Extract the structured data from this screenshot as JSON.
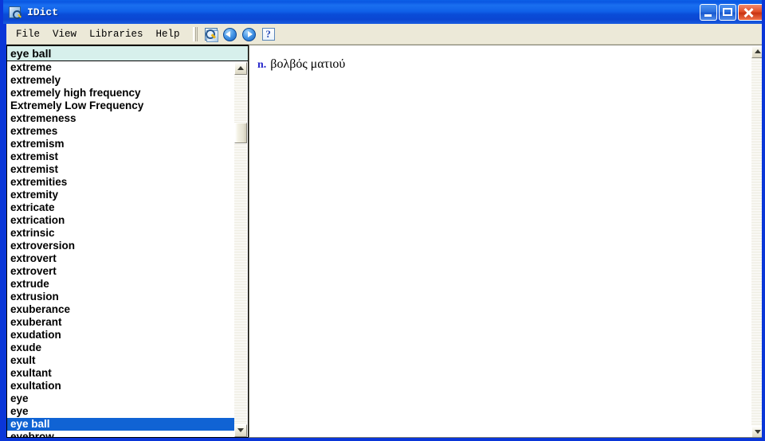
{
  "window": {
    "title": "IDict",
    "icon": "dictionary-book-icon",
    "controls": {
      "minimize": "Minimize",
      "maximize": "Maximize",
      "close": "Close"
    }
  },
  "menu": {
    "items": [
      {
        "label": "File"
      },
      {
        "label": "View"
      },
      {
        "label": "Libraries"
      },
      {
        "label": "Help"
      }
    ]
  },
  "toolbar": {
    "buttons": [
      {
        "name": "lookup-icon",
        "glyph": ""
      },
      {
        "name": "back-icon",
        "glyph": ""
      },
      {
        "name": "forward-icon",
        "glyph": ""
      },
      {
        "name": "help-icon",
        "glyph": "?"
      }
    ]
  },
  "search": {
    "value": "eye ball",
    "placeholder": ""
  },
  "wordlist": {
    "selected": "eye ball",
    "items": [
      "extreme",
      "extremely",
      "extremely high frequency",
      "Extremely Low Frequency",
      "extremeness",
      "extremes",
      "extremism",
      "extremist",
      "extremist",
      "extremities",
      "extremity",
      "extricate",
      "extrication",
      "extrinsic",
      "extroversion",
      "extrovert",
      "extrovert",
      "extrude",
      "extrusion",
      "exuberance",
      "exuberant",
      "exudation",
      "exude",
      "exult",
      "exultant",
      "exultation",
      "eye",
      "eye",
      "eye ball",
      "eyebrow"
    ]
  },
  "definition": {
    "entries": [
      {
        "pos": "n.",
        "text": "βολβός ματιού"
      }
    ]
  },
  "colors": {
    "title_bar": "#0A4CD8",
    "selection": "#1063D4",
    "search_field": "#D7F0EC",
    "menu_bar": "#ECE9D8",
    "pos_label": "#2B2BCC"
  }
}
